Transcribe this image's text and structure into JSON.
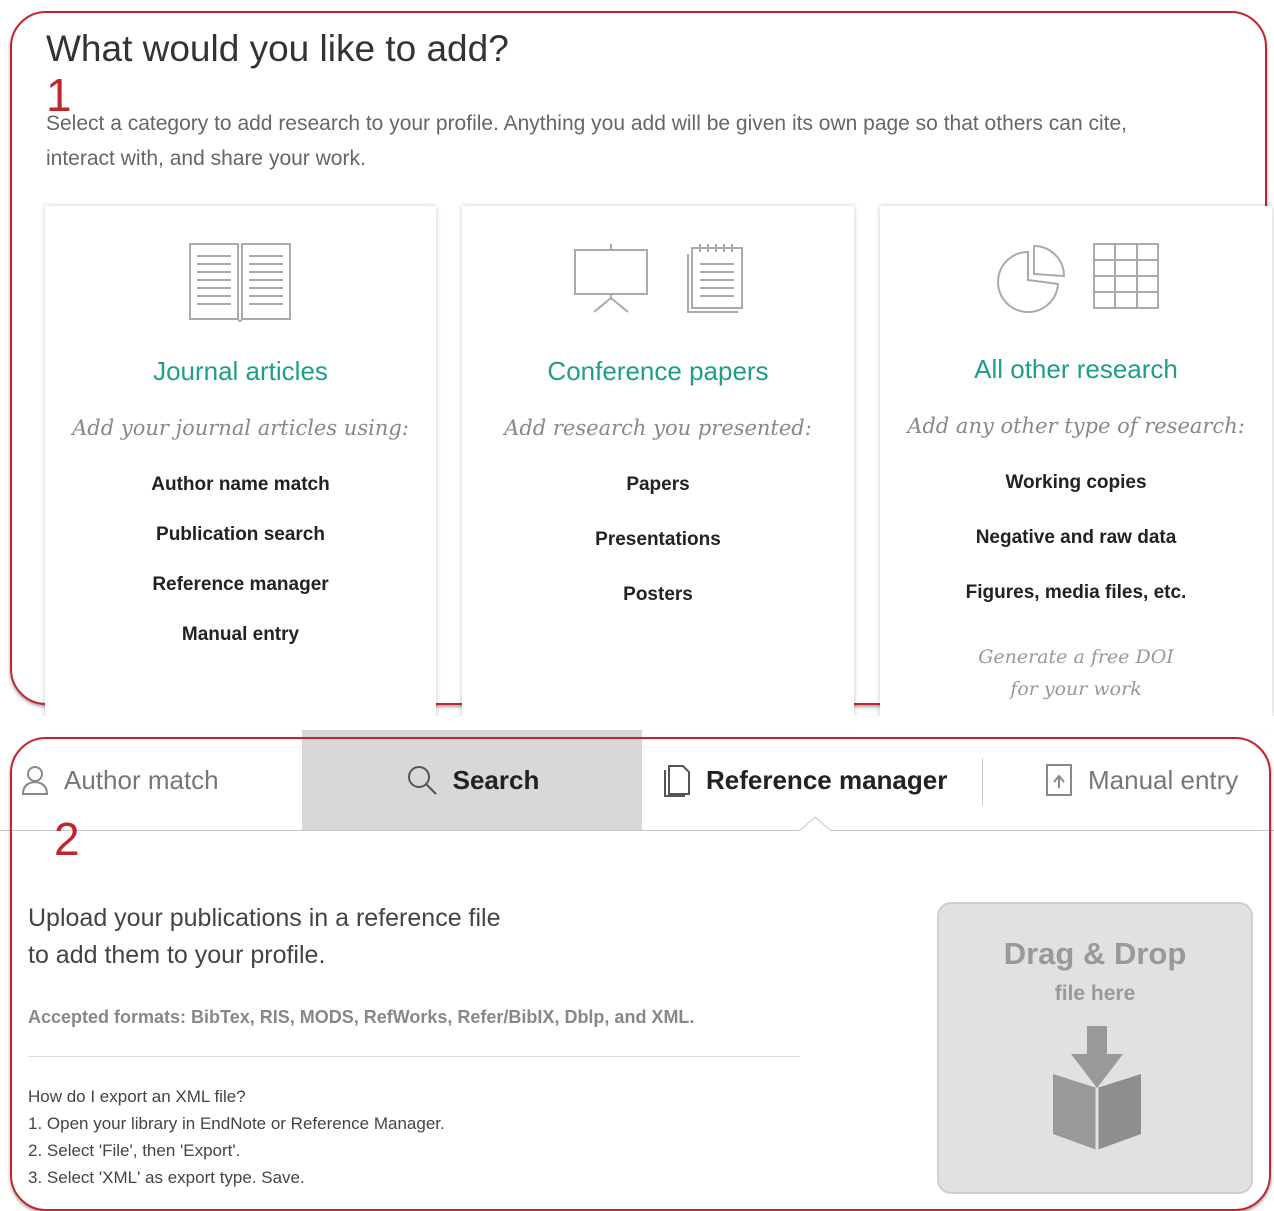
{
  "section1": {
    "marker": "1",
    "title": "What would you like to add?",
    "intro_line1": "Select a category to add research to your profile. Anything you add will be given its own page so that others can cite,",
    "intro_line2": "interact with, and share your work.",
    "cards": [
      {
        "title": "Journal articles",
        "subtitle": "Add your journal articles using:",
        "options": [
          "Author name match",
          "Publication search",
          "Reference manager",
          "Manual entry"
        ],
        "icons": [
          "open-book-icon"
        ]
      },
      {
        "title": "Conference papers",
        "subtitle": "Add research you presented:",
        "options": [
          "Papers",
          "Presentations",
          "Posters"
        ],
        "icons": [
          "presentation-board-icon",
          "notepad-icon"
        ]
      },
      {
        "title": "All other research",
        "subtitle": "Add any other type of research:",
        "options": [
          "Working copies",
          "Negative and raw data",
          "Figures, media files, etc."
        ],
        "note_line1": "Generate a free DOI",
        "note_line2": "for your work",
        "icons": [
          "pie-chart-icon",
          "data-table-icon"
        ]
      }
    ]
  },
  "section2": {
    "marker": "2",
    "tabs": [
      {
        "label": "Author match",
        "icon": "person-icon"
      },
      {
        "label": "Search",
        "icon": "search-icon"
      },
      {
        "label": "Reference manager",
        "icon": "document-icon"
      },
      {
        "label": "Manual entry",
        "icon": "upload-icon"
      }
    ],
    "upload_line1": "Upload your publications in a reference file",
    "upload_line2": "to add them to your profile.",
    "formats": "Accepted formats: BibTex, RIS, MODS, RefWorks, Refer/BibIX, Dblp, and XML.",
    "howto": [
      "How do I export an XML file?",
      "1. Open your library in EndNote or Reference Manager.",
      "2. Select 'File', then 'Export'.",
      "3. Select 'XML' as export type. Save."
    ],
    "dropzone": {
      "title": "Drag & Drop",
      "subtitle": "file here",
      "icon": "box-download-icon"
    }
  },
  "colors": {
    "accent_teal": "#1e9e8a",
    "annotation_red": "#c0272d",
    "active_tab_bg": "#d8d8d8"
  }
}
